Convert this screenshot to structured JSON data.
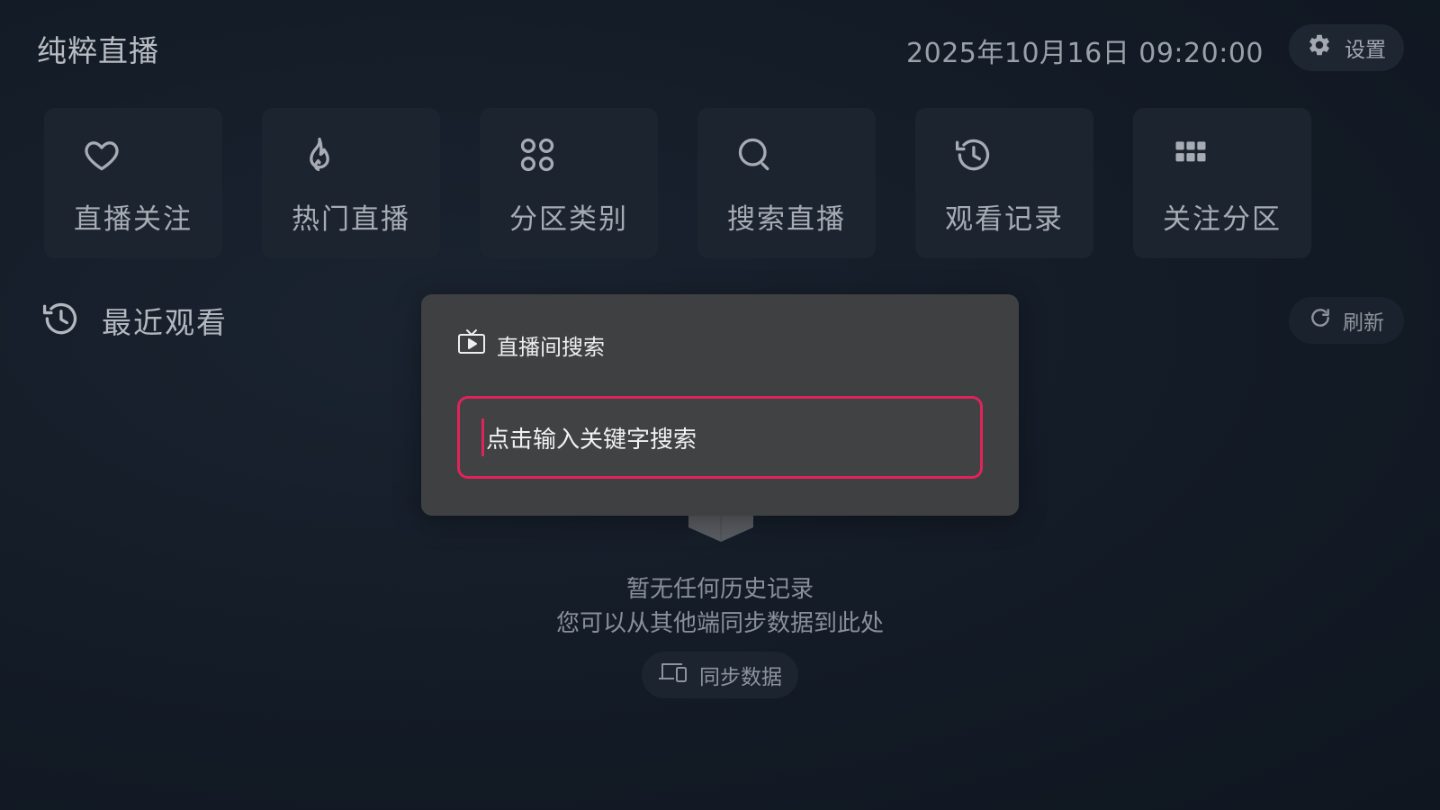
{
  "header": {
    "app_title": "纯粹直播",
    "datetime": "2025年10月16日 09:20:00",
    "settings_label": "设置"
  },
  "tiles": [
    {
      "label": "直播关注",
      "icon": "heart-icon"
    },
    {
      "label": "热门直播",
      "icon": "flame-icon"
    },
    {
      "label": "分区类别",
      "icon": "command-icon"
    },
    {
      "label": "搜索直播",
      "icon": "search-icon"
    },
    {
      "label": "观看记录",
      "icon": "history-icon"
    },
    {
      "label": "关注分区",
      "icon": "grid-icon"
    }
  ],
  "recent": {
    "title": "最近观看",
    "refresh_label": "刷新",
    "empty_line1": "暂无任何历史记录",
    "empty_line2": "您可以从其他端同步数据到此处",
    "sync_label": "同步数据"
  },
  "search_dialog": {
    "title": "直播间搜索",
    "placeholder": "点击输入关键字搜索"
  },
  "colors": {
    "accent": "#e0235b",
    "background": "#131b26",
    "tile": "#1c2430",
    "dialog": "#3f4042"
  }
}
